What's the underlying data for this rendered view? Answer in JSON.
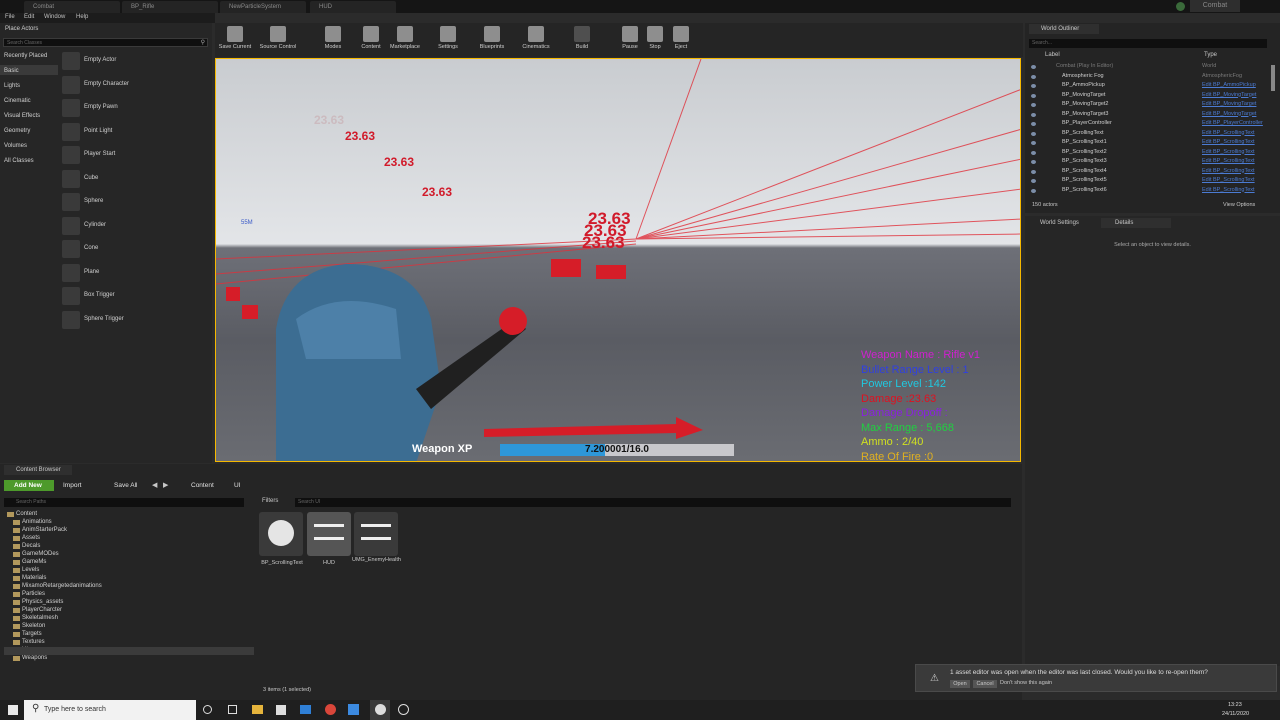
{
  "tabs": [
    "Combat",
    "BP_Rifle",
    "NewParticleSystem",
    "HUD"
  ],
  "project_badge": "Combat",
  "menu": [
    "File",
    "Edit",
    "Window",
    "Help"
  ],
  "place_actors": {
    "title": "Place Actors",
    "search_placeholder": "Search Classes",
    "categories": [
      "Recently Placed",
      "Basic",
      "Lights",
      "Cinematic",
      "Visual Effects",
      "Geometry",
      "Volumes",
      "All Classes"
    ],
    "items": [
      "Empty Actor",
      "Empty Character",
      "Empty Pawn",
      "Point Light",
      "Player Start",
      "Cube",
      "Sphere",
      "Cylinder",
      "Cone",
      "Plane",
      "Box Trigger",
      "Sphere Trigger"
    ]
  },
  "toolbar": [
    "Save Current",
    "Source Control",
    "Modes",
    "Content",
    "Marketplace",
    "Settings",
    "Blueprints",
    "Cinematics",
    "Build",
    "Pause",
    "Stop",
    "Eject"
  ],
  "viewport": {
    "damage_numbers": [
      "23.63",
      "23.63",
      "23.63",
      "23.63",
      "23.63",
      "23.63",
      "23.63"
    ],
    "hud": [
      {
        "text": "Weapon Name : Rifle v1",
        "color": "#d020d0"
      },
      {
        "text": "Bullet Range Level : 1",
        "color": "#3040e0"
      },
      {
        "text": "Power Level :142",
        "color": "#20c8e0"
      },
      {
        "text": "Damage :23.63",
        "color": "#e01020"
      },
      {
        "text": "Damage Dropoff :",
        "color": "#8a20e0"
      },
      {
        "text": "Max Range : 5,668",
        "color": "#20d040"
      },
      {
        "text": "Ammo : 2/40",
        "color": "#d0e020"
      },
      {
        "text": "Rate Of Fire :0",
        "color": "#e0b020"
      }
    ],
    "xp_label": "Weapon XP",
    "xp_value": "7.200001/16.0",
    "xp_progress": 0.45,
    "overhead_label": "55M"
  },
  "outliner": {
    "title": "World Outliner",
    "search_placeholder": "Search...",
    "col_label": "Label",
    "col_type": "Type",
    "rows": [
      {
        "name": "Combat (Play In Editor)",
        "type": "World"
      },
      {
        "name": "Atmospheric Fog",
        "type": "AtmosphericFog"
      },
      {
        "name": "BP_AmmoPickup",
        "type": "Edit BP_AmmoPickup"
      },
      {
        "name": "BP_MovingTarget",
        "type": "Edit BP_MovingTarget"
      },
      {
        "name": "BP_MovingTarget2",
        "type": "Edit BP_MovingTarget"
      },
      {
        "name": "BP_MovingTarget3",
        "type": "Edit BP_MovingTarget"
      },
      {
        "name": "BP_PlayerController",
        "type": "Edit BP_PlayerController"
      },
      {
        "name": "BP_ScrollingText",
        "type": "Edit BP_ScrollingText"
      },
      {
        "name": "BP_ScrollingText1",
        "type": "Edit BP_ScrollingText"
      },
      {
        "name": "BP_ScrollingText2",
        "type": "Edit BP_ScrollingText"
      },
      {
        "name": "BP_ScrollingText3",
        "type": "Edit BP_ScrollingText"
      },
      {
        "name": "BP_ScrollingText4",
        "type": "Edit BP_ScrollingText"
      },
      {
        "name": "BP_ScrollingText5",
        "type": "Edit BP_ScrollingText"
      },
      {
        "name": "BP_ScrollingText6",
        "type": "Edit BP_ScrollingText"
      }
    ],
    "count": "150 actors",
    "view_options": "View Options"
  },
  "details": {
    "tab_world": "World Settings",
    "tab_details": "Details",
    "empty": "Select an object to view details."
  },
  "content_browser": {
    "title": "Content Browser",
    "add_new": "Add New",
    "import": "Import",
    "save_all": "Save All",
    "path": [
      "Content",
      "UI"
    ],
    "search_paths": "Search Paths",
    "filters": "Filters",
    "search_ui": "Search UI",
    "folders": [
      "Content",
      "Animations",
      "AnimStarterPack",
      "Assets",
      "Decals",
      "GameMODes",
      "GameMs",
      "Levels",
      "Materials",
      "MixamoRetargetedanimations",
      "Particles",
      "Physics_assets",
      "PlayerCharcter",
      "Skeletalmesh",
      "Skeleton",
      "Targets",
      "Textures",
      "UI",
      "Weapons"
    ],
    "assets": [
      "BP_ScrollingText",
      "HUD",
      "UMG_EnemyHealth"
    ],
    "status": "3 items (1 selected)"
  },
  "notification": {
    "text": "1 asset editor was open when the editor was last closed. Would you like to re-open them?",
    "open": "Open",
    "cancel": "Cancel",
    "dont_show": "Don't show this again"
  },
  "taskbar": {
    "search": "Type here to search",
    "time": "13:23",
    "date": "24/11/2020"
  }
}
